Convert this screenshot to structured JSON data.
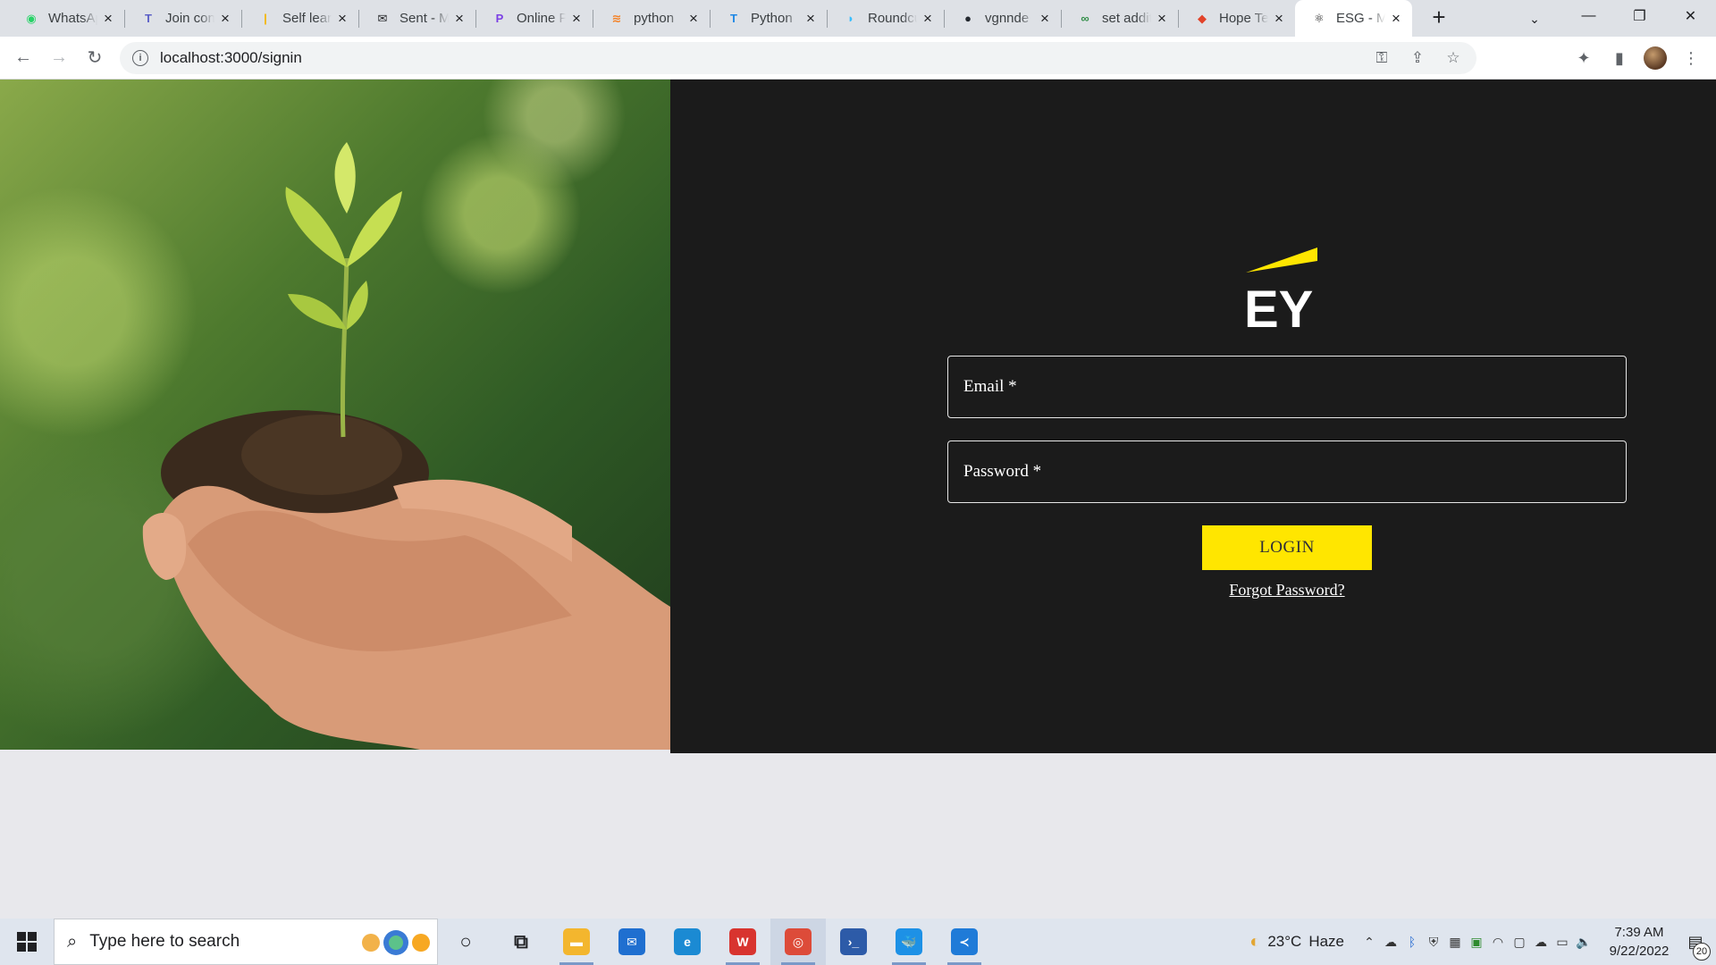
{
  "browser": {
    "tabs": [
      {
        "title": "WhatsApp",
        "icon": "whatsapp-icon",
        "color": "#25d366",
        "glyph": "◉"
      },
      {
        "title": "Join conversation",
        "icon": "teams-icon",
        "color": "#5b5fc7",
        "glyph": "T"
      },
      {
        "title": "Self learning",
        "icon": "bookmark-icon",
        "color": "#f4b400",
        "glyph": "|"
      },
      {
        "title": "Sent - Mail",
        "icon": "mail-icon",
        "color": "#202124",
        "glyph": "✉"
      },
      {
        "title": "Online Python",
        "icon": "p-logo-icon",
        "color": "#7b3fe4",
        "glyph": "P"
      },
      {
        "title": "python",
        "icon": "stackoverflow-icon",
        "color": "#f48024",
        "glyph": "≋"
      },
      {
        "title": "Python",
        "icon": "t-logo-icon",
        "color": "#1e88e5",
        "glyph": "T"
      },
      {
        "title": "Roundcube",
        "icon": "roundcube-icon",
        "color": "#37beff",
        "glyph": "◗"
      },
      {
        "title": "vgnnde",
        "icon": "github-icon",
        "color": "#24292f",
        "glyph": "●"
      },
      {
        "title": "set additional",
        "icon": "geeksforgeeks-icon",
        "color": "#2f8d46",
        "glyph": "∞"
      },
      {
        "title": "Hope Tech",
        "icon": "gitlab-icon",
        "color": "#e2432a",
        "glyph": "◆"
      },
      {
        "title": "ESG - Master",
        "icon": "react-icon",
        "color": "#222222",
        "glyph": "⚛",
        "active": true
      }
    ],
    "new_tab": "+",
    "url": "localhost:3000/signin"
  },
  "signin": {
    "logo_text": "EY",
    "brand_yellow": "#ffe600",
    "email_label": "Email *",
    "password_label": "Password *",
    "login_label": "LOGIN",
    "forgot_label": "Forgot Password?"
  },
  "taskbar": {
    "search_placeholder": "Type here to search",
    "weather_temp": "23°C",
    "weather_text": "Haze",
    "time": "7:39 AM",
    "date": "9/22/2022",
    "notification_count": "20",
    "apps": [
      {
        "name": "cortana-icon",
        "glyph": "○"
      },
      {
        "name": "task-view-icon",
        "glyph": "⧉"
      },
      {
        "name": "file-explorer-icon",
        "glyph": "▬",
        "running": true
      },
      {
        "name": "mail-app-icon",
        "glyph": "✉"
      },
      {
        "name": "edge-icon",
        "glyph": "e"
      },
      {
        "name": "wps-office-icon",
        "glyph": "W",
        "running": true
      },
      {
        "name": "chrome-icon",
        "glyph": "◎",
        "running": true,
        "active": true
      },
      {
        "name": "powershell-icon",
        "glyph": "›_"
      },
      {
        "name": "docker-icon",
        "glyph": "🐳",
        "running": true
      },
      {
        "name": "vscode-icon",
        "glyph": "≺",
        "running": true
      }
    ]
  }
}
